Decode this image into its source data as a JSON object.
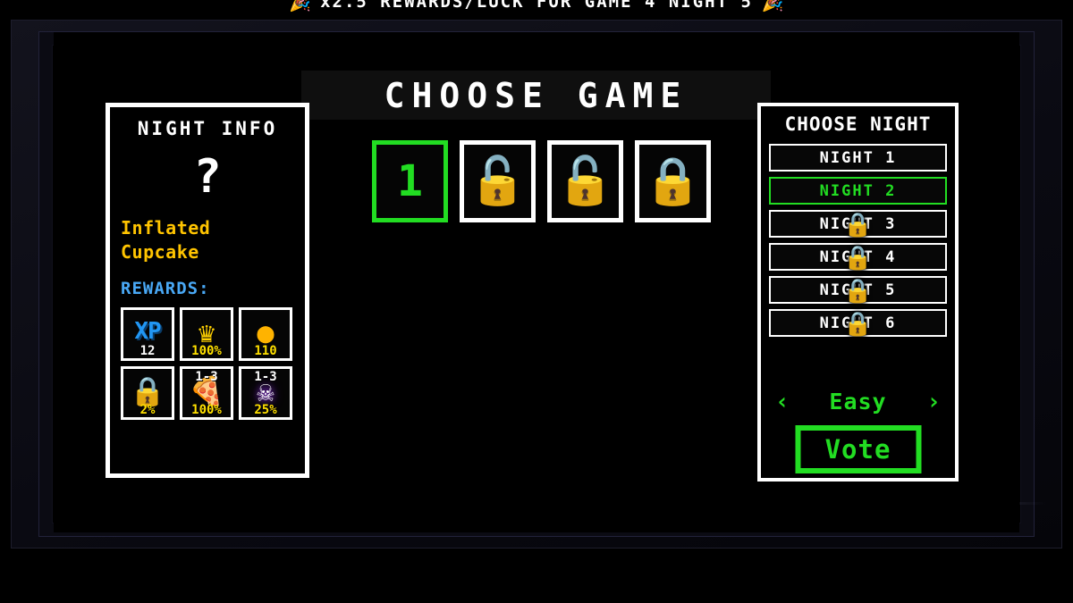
{
  "banner": {
    "text": "x2.5 REWARDS/LUCK FOR GAME 4 NIGHT 5",
    "left_emoji": "🎉",
    "right_emoji": "🎉"
  },
  "header": {
    "title": "CHOOSE GAME"
  },
  "night_info": {
    "title": "NIGHT INFO",
    "unknown_marker": "?",
    "subject_line1": "Inflated",
    "subject_line2": "Cupcake",
    "rewards_label": "REWARDS:",
    "subject_color": "#ffc400",
    "rewards_label_color": "#49a8f5",
    "rewards": [
      {
        "icon": "xp-icon",
        "glyph": "XP",
        "top": "",
        "bottom": "12",
        "bottom_color": "white"
      },
      {
        "icon": "crown-icon",
        "glyph": "♛",
        "top": "",
        "bottom": "100%",
        "bottom_color": "yellow"
      },
      {
        "icon": "coin-icon",
        "glyph": "●",
        "top": "",
        "bottom": "110",
        "bottom_color": "yellow"
      },
      {
        "icon": "lock-icon",
        "glyph": "🔒",
        "top": "",
        "bottom": "2%",
        "bottom_color": "yellow"
      },
      {
        "icon": "pizza-icon",
        "glyph": "🍕",
        "top": "1-3",
        "bottom": "100%",
        "bottom_color": "yellow"
      },
      {
        "icon": "skull-icon",
        "glyph": "☠",
        "top": "1-3",
        "bottom": "25%",
        "bottom_color": "yellow"
      }
    ]
  },
  "games": [
    {
      "label": "1",
      "locked": false,
      "lock_glyph": ""
    },
    {
      "label": "",
      "locked": true,
      "lock_glyph": "🔓"
    },
    {
      "label": "",
      "locked": true,
      "lock_glyph": "🔓"
    },
    {
      "label": "",
      "locked": true,
      "lock_glyph": "🔒"
    }
  ],
  "night_panel": {
    "title": "CHOOSE NIGHT",
    "items": [
      {
        "label": "NIGHT 1",
        "selected": false,
        "locked": false,
        "lock_glyph": ""
      },
      {
        "label": "NIGHT 2",
        "selected": true,
        "locked": false,
        "lock_glyph": ""
      },
      {
        "label": "NIGHT 3",
        "selected": false,
        "locked": true,
        "lock_glyph": "🔒"
      },
      {
        "label": "NIGHT 4",
        "selected": false,
        "locked": true,
        "lock_glyph": "🔒"
      },
      {
        "label": "NIGHT 5",
        "selected": false,
        "locked": true,
        "lock_glyph": "🔒"
      },
      {
        "label": "NIGHT 6",
        "selected": false,
        "locked": true,
        "lock_glyph": "🔒"
      }
    ],
    "difficulty": {
      "prev_arrow": "‹",
      "value": "Easy",
      "next_arrow": "›"
    },
    "vote_label": "Vote"
  },
  "colors": {
    "selected_green": "#22dd22",
    "panel_white": "#ffffff",
    "screen_black": "#000000"
  }
}
